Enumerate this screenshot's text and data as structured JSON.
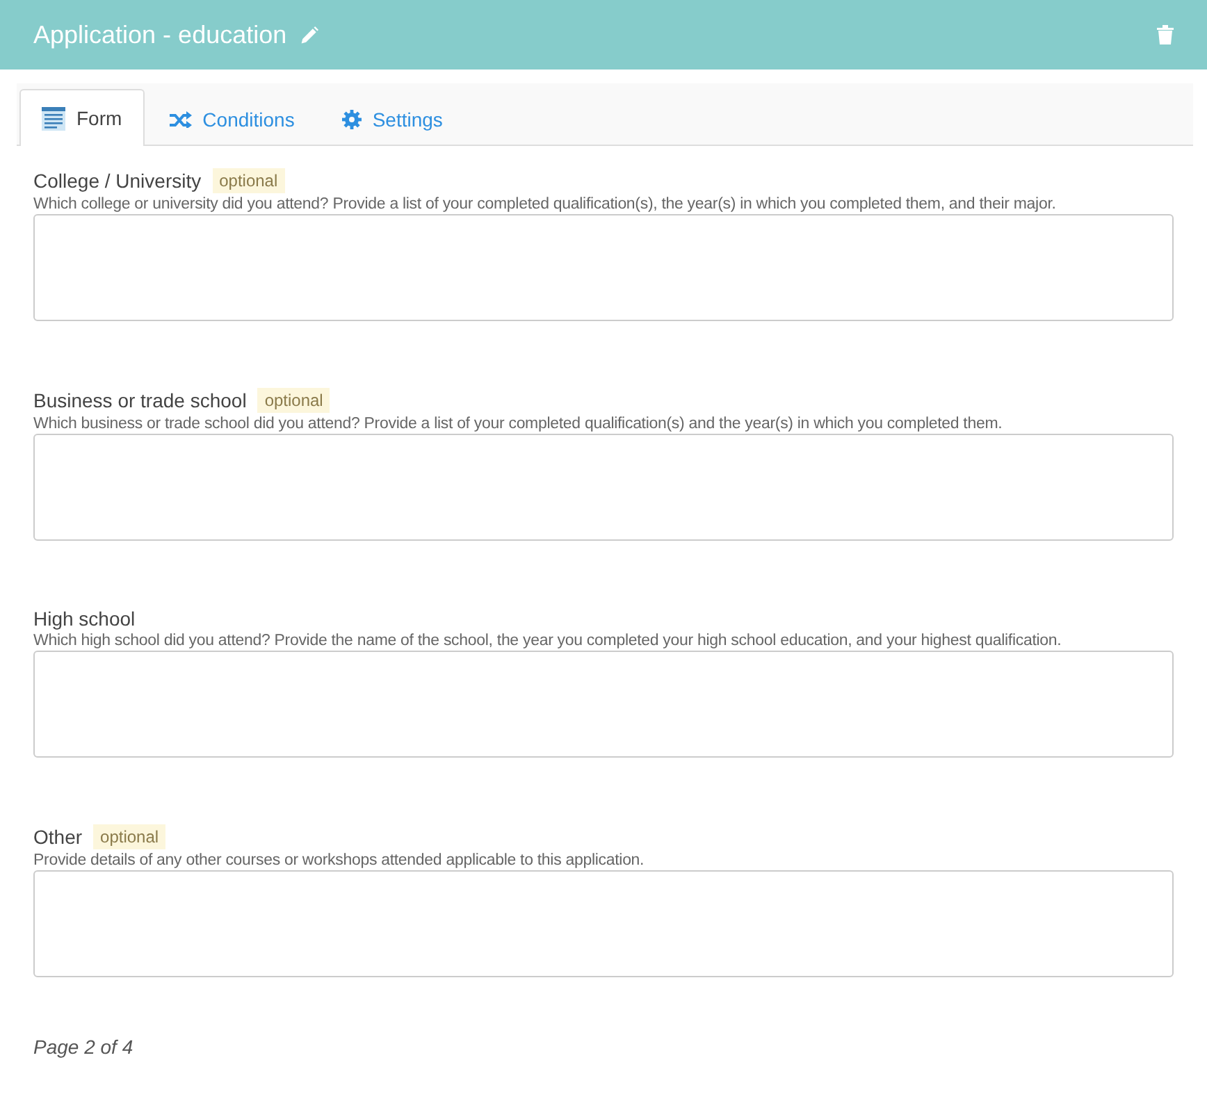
{
  "header": {
    "title": "Application - education"
  },
  "tabs": [
    {
      "label": "Form",
      "kind": "form",
      "selected": true
    },
    {
      "label": "Conditions",
      "kind": "conditions",
      "selected": false
    },
    {
      "label": "Settings",
      "kind": "settings",
      "selected": false
    }
  ],
  "fields": [
    {
      "label": "College / University",
      "optional": true,
      "badge": "optional",
      "help": "Which college or university did you attend? Provide a list of your completed qualification(s), the year(s) in which you completed them, and their major."
    },
    {
      "label": "Business or trade school",
      "optional": true,
      "badge": "optional",
      "help": "Which business or trade school did you attend? Provide a list of your completed qualification(s) and the year(s) in which you completed them."
    },
    {
      "label": "High school",
      "optional": false,
      "help": "Which high school did you attend? Provide the name of the school, the year you completed your high school education, and your highest qualification."
    },
    {
      "label": "Other",
      "optional": true,
      "badge": "optional",
      "help": "Provide details of any other courses or workshops attended applicable to this application."
    }
  ],
  "footer": {
    "page": "Page 2 of 4"
  }
}
